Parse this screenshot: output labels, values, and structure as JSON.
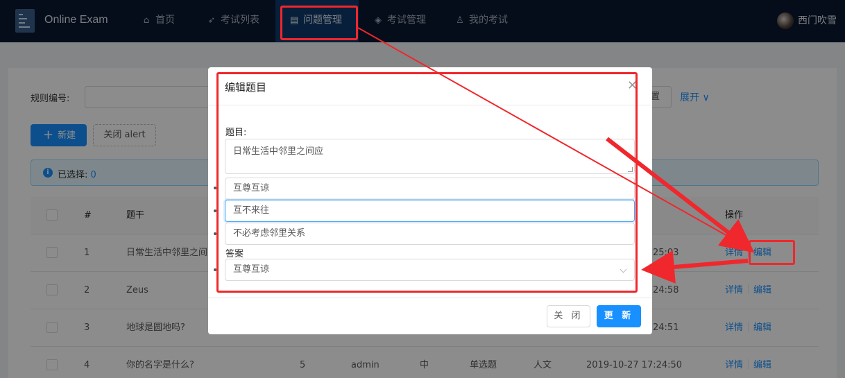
{
  "header": {
    "app_title": "Online Exam",
    "nav": [
      {
        "label": "首页",
        "icon": "home-icon"
      },
      {
        "label": "考试列表",
        "icon": "rocket-icon"
      },
      {
        "label": "问题管理",
        "icon": "file-icon",
        "active": true
      },
      {
        "label": "考试管理",
        "icon": "coins-icon"
      },
      {
        "label": "我的考试",
        "icon": "user-icon"
      }
    ],
    "user_name": "西门吹雪"
  },
  "filter": {
    "rule_label": "规则编号:",
    "reset_label": "置",
    "expand_label": "展开"
  },
  "toolbar": {
    "new_label": "新建",
    "close_alert_label": "关闭 alert"
  },
  "alert": {
    "text": "已选择:",
    "count": "0"
  },
  "table": {
    "headers": {
      "index": "#",
      "stem": "题干",
      "ops": "操作"
    },
    "rows": [
      {
        "index": "1",
        "stem": "日常生活中邻里之间",
        "score": "",
        "creator": "",
        "level": "",
        "qtype": "",
        "category": "",
        "time": "25:03"
      },
      {
        "index": "2",
        "stem": "Zeus",
        "score": "",
        "creator": "",
        "level": "",
        "qtype": "",
        "category": "",
        "time": "24:58"
      },
      {
        "index": "3",
        "stem": "地球是圆地吗?",
        "score": "",
        "creator": "",
        "level": "",
        "qtype": "",
        "category": "",
        "time": "24:51"
      },
      {
        "index": "4",
        "stem": "你的名字是什么?",
        "score": "5",
        "creator": "admin",
        "level": "中",
        "qtype": "单选题",
        "category": "人文",
        "time": "2019-10-27 17:24:50"
      }
    ],
    "detail_label": "详情",
    "edit_label": "编辑"
  },
  "modal": {
    "title": "编辑题目",
    "question_label": "题目:",
    "question_value": "日常生活中邻里之间应",
    "options": [
      "互尊互谅",
      "互不来往",
      "不必考虑邻里关系"
    ],
    "answer_label": "答案",
    "answer_value": "互尊互谅",
    "close_label": "关 闭",
    "update_label": "更 新"
  },
  "colors": {
    "header_bg": "#0a1830",
    "primary": "#1890ff",
    "annotation": "#f0272c"
  }
}
